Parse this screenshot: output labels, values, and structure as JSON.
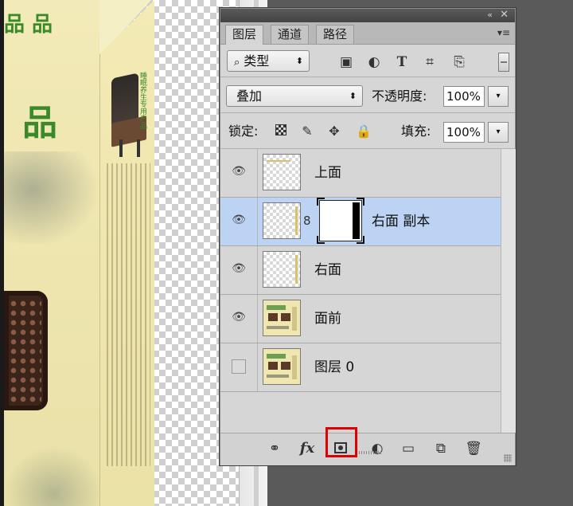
{
  "panel": {
    "titlebar": {
      "collapse_icon": "«",
      "close_icon": "✕"
    },
    "tabs": [
      {
        "label": "图层",
        "active": true
      },
      {
        "label": "通道",
        "active": false
      },
      {
        "label": "路径",
        "active": false
      }
    ],
    "menu_icon": "▾≡",
    "filter": {
      "label": "类型",
      "search_glyph": "⌕",
      "arrows": "⬍",
      "icons": [
        "▣",
        "◐",
        "T",
        "⌗",
        "⎘"
      ]
    },
    "blend": {
      "mode": "叠加",
      "arrows": "⬍",
      "opacity_label": "不透明度:",
      "opacity_value": "100%",
      "dropdown_glyph": "▾"
    },
    "lock": {
      "label": "锁定:",
      "icons": [
        "▦",
        "✎",
        "✥",
        "🔒"
      ],
      "fill_label": "填充:",
      "fill_value": "100%",
      "dropdown_glyph": "▾"
    },
    "layers": [
      {
        "name": "上面",
        "visible": true,
        "selected": false,
        "mask": false,
        "thumb": "top-strip"
      },
      {
        "name": "右面 副本",
        "visible": true,
        "selected": true,
        "mask": true,
        "thumb": "side-strip"
      },
      {
        "name": "右面",
        "visible": true,
        "selected": false,
        "mask": false,
        "thumb": "side-strip"
      },
      {
        "name": "面前",
        "visible": true,
        "selected": false,
        "mask": false,
        "thumb": "box"
      },
      {
        "name": "图层 0",
        "visible": false,
        "selected": false,
        "mask": false,
        "thumb": "box"
      }
    ],
    "eye_glyph": "👁",
    "chain_glyph": "8",
    "bottom_toolbar": {
      "link_icon": "⚭",
      "fx_label": "fx",
      "adjustment_icon": "◐",
      "folder_icon": "▭",
      "new_layer_icon": "⧉",
      "trash_icon": "🗑"
    },
    "highlight_color": "#e00000",
    "selected_row_color": "#bcd3f4"
  },
  "canvas": {
    "front_text_1": "品 品",
    "front_text_2": "品",
    "side_title": "睡眠养生专用产品"
  }
}
